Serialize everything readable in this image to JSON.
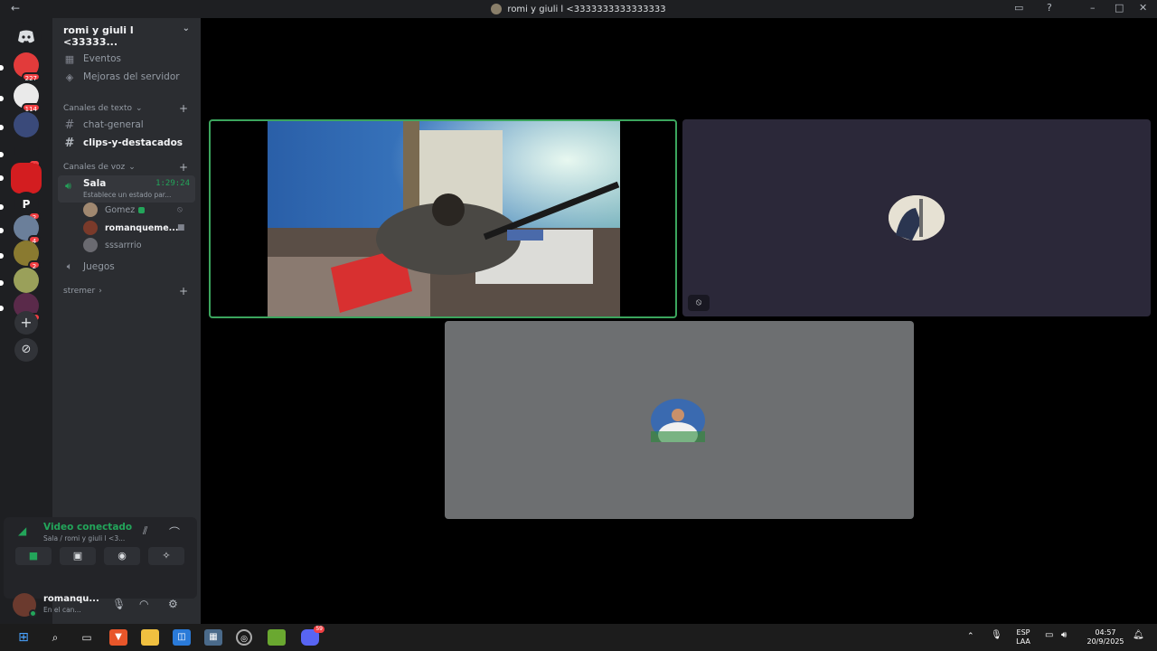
{
  "titlebar": {
    "back": "←",
    "title": "romi y giuli l <3333333333333333",
    "icons": [
      "inbox-icon",
      "help-icon",
      "minimize-icon",
      "maximize-icon",
      "close-icon"
    ]
  },
  "guilds": [
    {
      "badge": "227",
      "color": "#e23b3b"
    },
    {
      "badge": "114",
      "color": "#eaeaea"
    },
    {
      "badge": "",
      "color": "#3a4a7a"
    },
    {
      "badge": "1",
      "color": "#1e1f22"
    },
    {
      "badge": "",
      "color": "#d31d20"
    },
    {
      "badge": "2",
      "color": "#1e1f22",
      "letter": "P"
    },
    {
      "badge": "4",
      "color": "#6b7f9a"
    },
    {
      "badge": "2",
      "color": "#8a7a30"
    },
    {
      "badge": "",
      "color": "#9aa05a"
    },
    {
      "badge": "21",
      "color": "#5a2a4a"
    }
  ],
  "server": {
    "name": "romi y giuli l <33333...",
    "chevron": "⌄"
  },
  "nav": {
    "events": "Eventos",
    "boosts": "Mejoras del servidor"
  },
  "text_category": "Canales de texto",
  "text_channels": [
    "chat-general",
    "clips-y-destacados"
  ],
  "voice_category": "Canales de voz",
  "sala": {
    "name": "Sala",
    "timer": "1:29:24",
    "status": "Establece un estado par..."
  },
  "voice_users": [
    {
      "name": "Gomez",
      "color": "#a08870"
    },
    {
      "name": "romanqueme...",
      "color": "#7a3a2a"
    },
    {
      "name": "sssarrrio",
      "color": "#6a6a70"
    }
  ],
  "voice_channel_2": "Juegos",
  "streamer_category": "stremer",
  "voice_panel": {
    "title": "Video conectado",
    "subtitle": "Sala / romi y giuli l <3..."
  },
  "user": {
    "name": "romanqu...",
    "status": "En el can..."
  },
  "taskbar": {
    "lang_top": "ESP",
    "lang_bottom": "LAA",
    "time": "04:57",
    "date": "20/9/2025",
    "discord_badge": "59"
  }
}
